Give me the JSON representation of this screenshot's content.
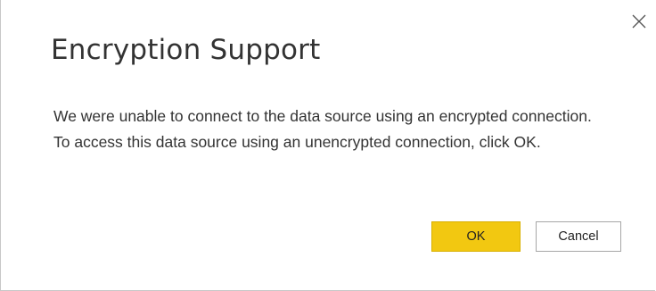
{
  "dialog": {
    "title": "Encryption Support",
    "message": "We were unable to connect to the data source using an encrypted connection. To access this data source using an unencrypted connection, click OK.",
    "close_icon": "close-icon",
    "buttons": {
      "ok_label": "OK",
      "cancel_label": "Cancel"
    },
    "colors": {
      "ok_button_bg": "#f2c811",
      "text": "#333333",
      "border": "#c8c8c8"
    }
  }
}
